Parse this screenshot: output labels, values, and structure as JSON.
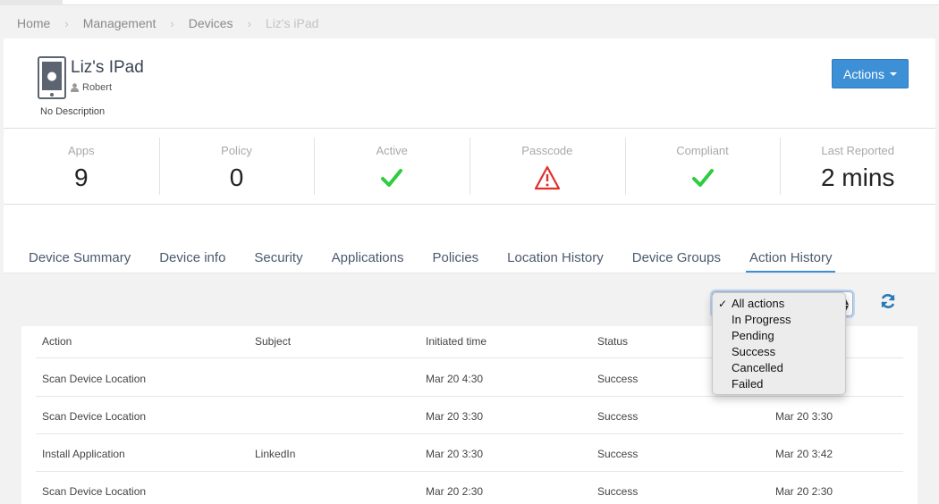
{
  "breadcrumb": {
    "items": [
      "Home",
      "Management",
      "Devices"
    ],
    "current": "Liz's iPad"
  },
  "device": {
    "name": "Liz's IPad",
    "owner": "Robert",
    "description": "No Description",
    "icon": "ipad-icon"
  },
  "actions_button": {
    "label": "Actions"
  },
  "stats": [
    {
      "label": "Apps",
      "value": "9"
    },
    {
      "label": "Policy",
      "value": "0"
    },
    {
      "label": "Active",
      "icon": "green-check-icon"
    },
    {
      "label": "Passcode",
      "icon": "red-warning-icon"
    },
    {
      "label": "Compliant",
      "icon": "green-check-icon"
    },
    {
      "label": "Last Reported",
      "value": "2 mins"
    }
  ],
  "tabs": [
    "Device Summary",
    "Device info",
    "Security",
    "Applications",
    "Policies",
    "Location History",
    "Device Groups",
    "Action History"
  ],
  "active_tab": "Action History",
  "filter": {
    "selected": "All actions",
    "options": [
      "All actions",
      "In Progress",
      "Pending",
      "Success",
      "Cancelled",
      "Failed"
    ]
  },
  "table": {
    "headers": [
      "Action",
      "Subject",
      "Initiated time",
      "Status",
      ""
    ],
    "rows": [
      [
        "Scan Device Location",
        "",
        "Mar 20 4:30",
        "Success",
        ""
      ],
      [
        "Scan Device Location",
        "",
        "Mar 20 3:30",
        "Success",
        "Mar 20 3:30"
      ],
      [
        "Install Application",
        "LinkedIn",
        "Mar 20 3:30",
        "Success",
        "Mar 20 3:42"
      ],
      [
        "Scan Device Location",
        "",
        "Mar 20 2:30",
        "Success",
        "Mar 20 2:30"
      ]
    ]
  },
  "colors": {
    "accent": "#3d8fd6",
    "success": "#2ecc40",
    "danger": "#e0302b",
    "text_nav": "#4b5a6e"
  }
}
